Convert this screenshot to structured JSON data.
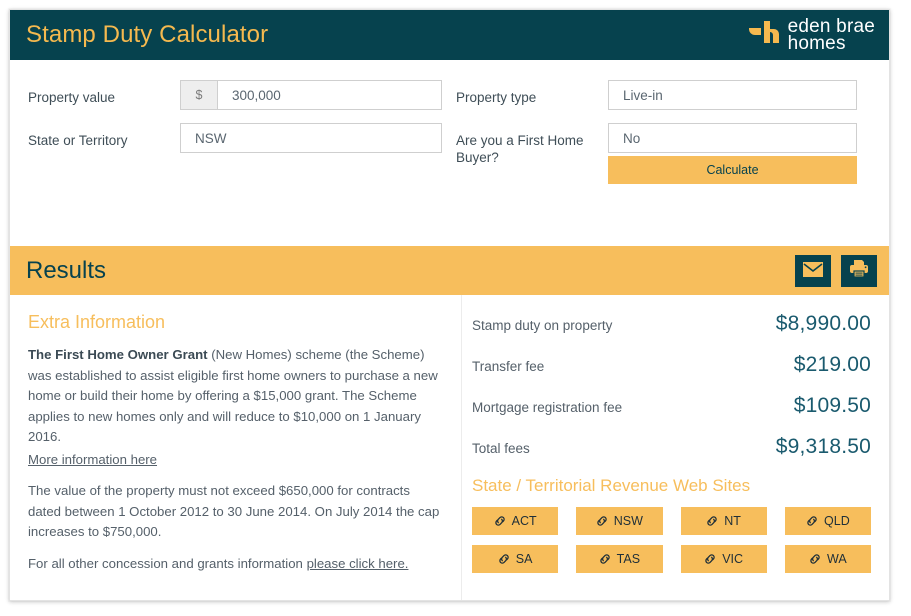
{
  "header": {
    "title": "Stamp Duty Calculator",
    "logo": {
      "line1": "eden brae",
      "line2": "homes",
      "mark": "eden-brae-mark"
    }
  },
  "form": {
    "fields": [
      {
        "label": "Property value",
        "addon": "$",
        "value": "300,000",
        "name": "property-value"
      },
      {
        "label": "Property type",
        "value": "Live-in",
        "name": "property-type"
      },
      {
        "label": "State or Territory",
        "value": "NSW",
        "name": "state-or-territory"
      },
      {
        "label": "Are you a First Home Buyer?",
        "value": "No",
        "name": "first-home-buyer"
      }
    ],
    "calculate_label": "Calculate"
  },
  "results": {
    "title": "Results",
    "email_icon": "envelope-icon",
    "print_icon": "printer-icon",
    "figures": [
      {
        "label": "Stamp duty on property",
        "value": "$8,990.00"
      },
      {
        "label": "Transfer fee",
        "value": "$219.00"
      },
      {
        "label": "Mortgage registration fee",
        "value": "$109.50"
      },
      {
        "label": "Total fees",
        "value": "$9,318.50"
      }
    ],
    "sites_heading": "State / Territorial Revenue Web Sites",
    "sites": [
      {
        "label": "ACT"
      },
      {
        "label": "NSW"
      },
      {
        "label": "NT"
      },
      {
        "label": "QLD"
      },
      {
        "label": "SA"
      },
      {
        "label": "TAS"
      },
      {
        "label": "VIC"
      },
      {
        "label": "WA"
      }
    ]
  },
  "extra": {
    "heading": "Extra Information",
    "p1_bold": "The First Home Owner Grant",
    "p1_rest": " (New Homes) scheme (the Scheme) was established to assist eligible first home owners to purchase a new home or build their home by offering a $15,000 grant. The Scheme applies to new homes only and will reduce to $10,000 on 1 January 2016.",
    "p1_link": "More information here",
    "p2": "The value of the property must not exceed $650,000 for contracts dated between 1 October 2012 to 30 June 2014. On July 2014 the cap increases to $750,000.",
    "p3_prefix": "For all other concession and grants information ",
    "p3_link": "please click here."
  },
  "colors": {
    "teal": "#06424E",
    "orange": "#F7BE5C",
    "value_blue": "#1A5A6E",
    "body_text": "#55606A"
  }
}
